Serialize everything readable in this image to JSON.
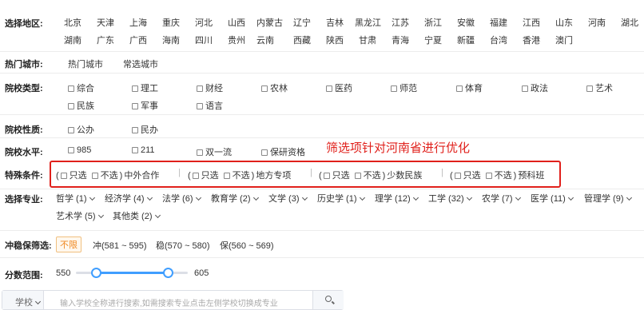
{
  "region": {
    "label": "选择地区:",
    "row1": [
      "北京",
      "天津",
      "上海",
      "重庆",
      "河北",
      "山西",
      "内蒙古",
      "辽宁",
      "吉林",
      "黑龙江",
      "江苏",
      "浙江",
      "安徽",
      "福建",
      "江西",
      "山东",
      "河南",
      "湖北"
    ],
    "row2": [
      "湖南",
      "广东",
      "广西",
      "海南",
      "四川",
      "贵州",
      "云南",
      "西藏",
      "陕西",
      "甘肃",
      "青海",
      "宁夏",
      "新疆",
      "台湾",
      "香港",
      "澳门"
    ]
  },
  "hot_city": {
    "label": "热门城市:",
    "options": [
      "热门城市",
      "常选城市"
    ]
  },
  "school_type": {
    "label": "院校类型:",
    "row1": [
      "综合",
      "理工",
      "财经",
      "农林",
      "医药",
      "师范",
      "体育",
      "政法",
      "艺术"
    ],
    "row2": [
      "民族",
      "军事",
      "语言"
    ]
  },
  "school_nature": {
    "label": "院校性质:",
    "options": [
      "公办",
      "民办"
    ]
  },
  "school_level": {
    "label": "院校水平:",
    "options": [
      "985",
      "211",
      "双一流",
      "保研资格"
    ]
  },
  "annotation": "筛选项针对河南省进行优化",
  "special": {
    "label": "特殊条件:",
    "groups": [
      {
        "open": "(",
        "only": "只选",
        "exclude": "不选",
        "close": ")",
        "name": "中外合作"
      },
      {
        "open": "(",
        "only": "只选",
        "exclude": "不选",
        "close": ")",
        "name": "地方专项"
      },
      {
        "open": "(",
        "only": "只选",
        "exclude": "不选",
        "close": ")",
        "name": "少数民族"
      },
      {
        "open": "(",
        "only": "只选",
        "exclude": "不选",
        "close": ")",
        "name": "预科班"
      }
    ]
  },
  "major": {
    "label": "选择专业:",
    "row1": [
      "哲学 (1)",
      "经济学 (4)",
      "法学 (6)",
      "教育学 (2)",
      "文学 (3)",
      "历史学 (1)",
      "理学 (12)",
      "工学 (32)",
      "农学 (7)",
      "医学 (11)",
      "管理学 (9)"
    ],
    "row2": [
      "艺术学 (5)",
      "其他类 (2)"
    ]
  },
  "risk": {
    "label": "冲稳保筛选:",
    "unlimited": "不限",
    "chong": "冲(581 ~ 595)",
    "wen": "稳(570 ~ 580)",
    "bao": "保(560 ~ 569)"
  },
  "score": {
    "label": "分数范围:",
    "min": "550",
    "max": "605",
    "low_fraction": 0.18,
    "high_fraction": 0.82
  },
  "search": {
    "select": "学校",
    "placeholder": "输入学校全称进行搜索,如需搜索专业点击左侧学校切换成专业"
  },
  "colors": {
    "accent": "#409eff",
    "annotation": "#e0201b",
    "tag": "#f08a24"
  }
}
